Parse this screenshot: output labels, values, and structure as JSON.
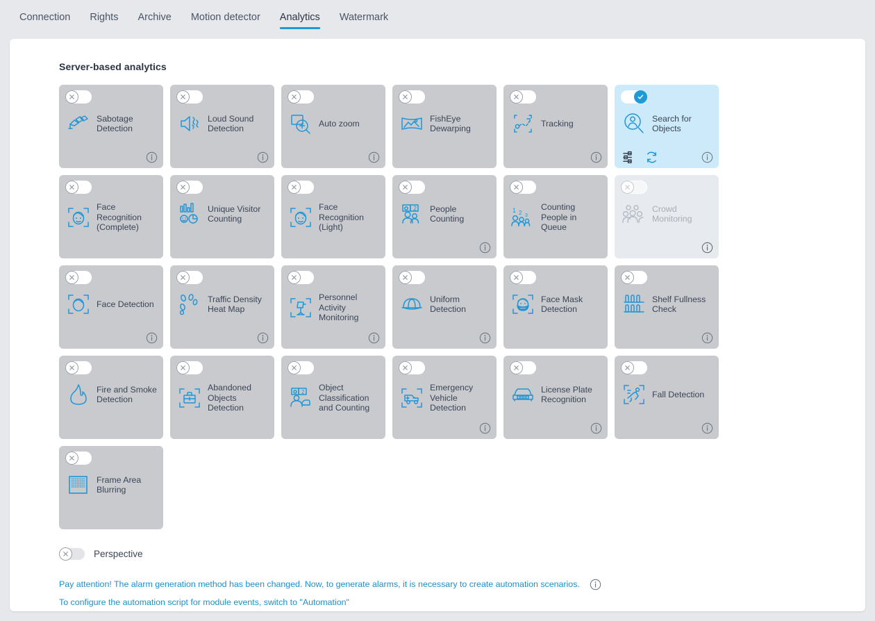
{
  "tabs": [
    {
      "label": "Connection",
      "active": false
    },
    {
      "label": "Rights",
      "active": false
    },
    {
      "label": "Archive",
      "active": false
    },
    {
      "label": "Motion detector",
      "active": false
    },
    {
      "label": "Analytics",
      "active": true
    },
    {
      "label": "Watermark",
      "active": false
    }
  ],
  "accent_color": "#1e9ad6",
  "section": {
    "title": "Server-based analytics"
  },
  "cards": [
    {
      "label": "Sabotage Detection",
      "icon": "sabotage-detection-icon",
      "enabled": false,
      "disabled": false,
      "info": true
    },
    {
      "label": "Loud Sound Detection",
      "icon": "loud-sound-detection-icon",
      "enabled": false,
      "disabled": false,
      "info": true
    },
    {
      "label": "Auto zoom",
      "icon": "auto-zoom-icon",
      "enabled": false,
      "disabled": false,
      "info": true
    },
    {
      "label": "FishEye Dewarping",
      "icon": "fisheye-dewarping-icon",
      "enabled": false,
      "disabled": false,
      "info": false
    },
    {
      "label": "Tracking",
      "icon": "tracking-icon",
      "enabled": false,
      "disabled": false,
      "info": true
    },
    {
      "label": "Search for Objects",
      "icon": "search-for-objects-icon",
      "enabled": true,
      "disabled": false,
      "info": true,
      "actions": [
        "settings-sliders-icon",
        "refresh-icon"
      ]
    },
    {
      "label": "Face Recognition (Complete)",
      "icon": "face-recognition-complete-icon",
      "enabled": false,
      "disabled": false,
      "info": false
    },
    {
      "label": "Unique Visitor Counting",
      "icon": "unique-visitor-counting-icon",
      "enabled": false,
      "disabled": false,
      "info": false
    },
    {
      "label": "Face Recognition (Light)",
      "icon": "face-recognition-light-icon",
      "enabled": false,
      "disabled": false,
      "info": false
    },
    {
      "label": "People Counting",
      "icon": "people-counting-icon",
      "enabled": false,
      "disabled": false,
      "info": true
    },
    {
      "label": "Counting People in Queue",
      "icon": "counting-people-queue-icon",
      "enabled": false,
      "disabled": false,
      "info": false
    },
    {
      "label": "Crowd Monitoring",
      "icon": "crowd-monitoring-icon",
      "enabled": false,
      "disabled": true,
      "info": true
    },
    {
      "label": "Face Detection",
      "icon": "face-detection-icon",
      "enabled": false,
      "disabled": false,
      "info": true
    },
    {
      "label": "Traffic Density Heat Map",
      "icon": "traffic-density-heatmap-icon",
      "enabled": false,
      "disabled": false,
      "info": true
    },
    {
      "label": "Personnel Activity Monitoring",
      "icon": "personnel-activity-icon",
      "enabled": false,
      "disabled": false,
      "info": true
    },
    {
      "label": "Uniform Detection",
      "icon": "uniform-detection-icon",
      "enabled": false,
      "disabled": false,
      "info": true
    },
    {
      "label": "Face Mask Detection",
      "icon": "face-mask-detection-icon",
      "enabled": false,
      "disabled": false,
      "info": false
    },
    {
      "label": "Shelf Fullness Check",
      "icon": "shelf-fullness-icon",
      "enabled": false,
      "disabled": false,
      "info": true
    },
    {
      "label": "Fire and Smoke Detection",
      "icon": "fire-smoke-detection-icon",
      "enabled": false,
      "disabled": false,
      "info": false
    },
    {
      "label": "Abandoned Objects Detection",
      "icon": "abandoned-objects-icon",
      "enabled": false,
      "disabled": false,
      "info": false
    },
    {
      "label": "Object Classification and Counting",
      "icon": "object-classification-icon",
      "enabled": false,
      "disabled": false,
      "info": false
    },
    {
      "label": "Emergency Vehicle Detection",
      "icon": "emergency-vehicle-icon",
      "enabled": false,
      "disabled": false,
      "info": true
    },
    {
      "label": "License Plate Recognition",
      "icon": "license-plate-icon",
      "enabled": false,
      "disabled": false,
      "info": true
    },
    {
      "label": "Fall Detection",
      "icon": "fall-detection-icon",
      "enabled": false,
      "disabled": false,
      "info": true
    },
    {
      "label": "Frame Area Blurring",
      "icon": "frame-area-blurring-icon",
      "enabled": false,
      "disabled": false,
      "info": false
    }
  ],
  "perspective": {
    "label": "Perspective",
    "enabled": false
  },
  "notice": {
    "line1": "Pay attention! The alarm generation method has been changed. Now, to generate alarms, it is necessary to create automation scenarios.",
    "line2": "To configure the automation script for module events, switch to \"Automation\""
  }
}
